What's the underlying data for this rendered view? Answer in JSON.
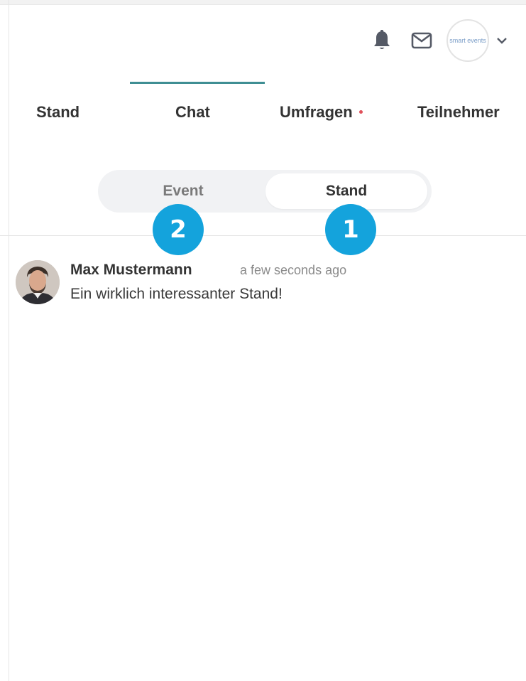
{
  "header": {
    "notification_icon": "bell-icon",
    "messages_icon": "envelope-icon",
    "profile_logo_text": "smart events",
    "menu_icon": "chevron-down-icon"
  },
  "tabs": [
    {
      "label": "Stand"
    },
    {
      "label": "Chat",
      "active": true
    },
    {
      "label": "Umfragen",
      "has_notification": true
    },
    {
      "label": "Teilnehmer"
    }
  ],
  "chat_scope": {
    "options": [
      {
        "label": "Event"
      },
      {
        "label": "Stand",
        "selected": true
      }
    ]
  },
  "callouts": [
    {
      "number": "1"
    },
    {
      "number": "2"
    }
  ],
  "messages": [
    {
      "author": "Max Mustermann",
      "time": "a few seconds ago",
      "text": "Ein wirklich interessanter Stand!"
    }
  ],
  "colors": {
    "accent": "#3f8e93",
    "callout": "#14a3dc",
    "notification_dot": "#e0505a"
  }
}
